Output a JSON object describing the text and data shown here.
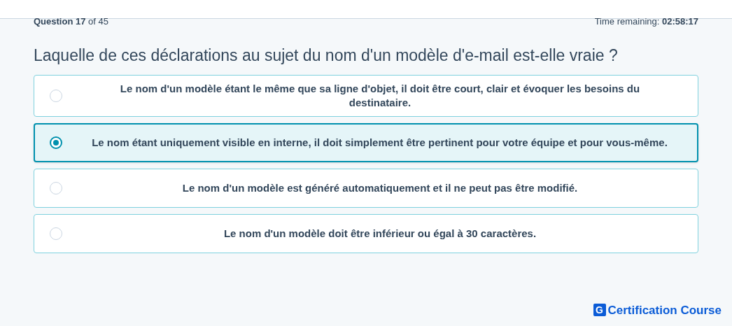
{
  "progress": "**Question 17** of 45",
  "timer": "Time remaining: **02:58:17**",
  "question": "Laquelle de ces déclarations au sujet du nom d'un modèle d'e-mail est-elle vraie ?",
  "options": [
    {
      "text": "Le nom d'un modèle étant le même que sa ligne d'objet, il doit être court, clair et évoquer les besoins du destinataire.",
      "selected": false
    },
    {
      "text": "Le nom étant uniquement visible en interne, il doit simplement être pertinent pour votre équipe et pour vous-même.",
      "selected": true
    },
    {
      "text": "Le nom d'un modèle est généré automatiquement et il ne peut pas être modifié.",
      "selected": false
    },
    {
      "text": "Le nom d'un modèle doit être inférieur ou égal à 30 caractères.",
      "selected": false
    }
  ],
  "brand": {
    "mark": "G",
    "name": "Certification Course"
  }
}
